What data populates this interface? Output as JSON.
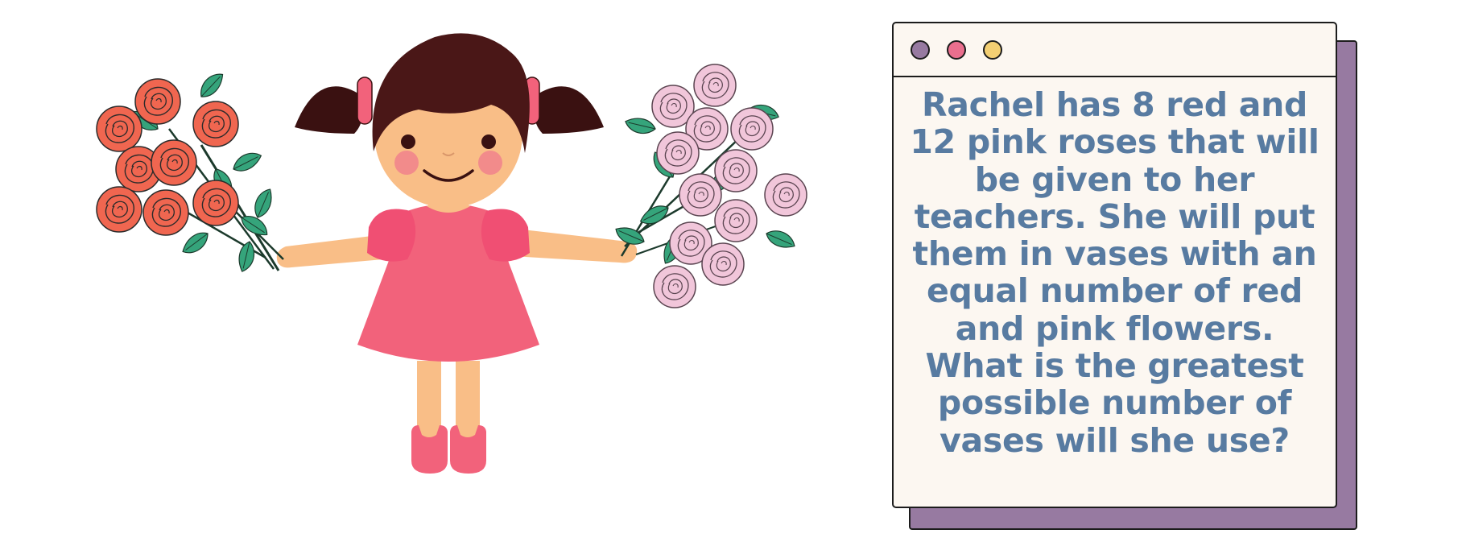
{
  "colors": {
    "window_bg": "#fcf7f1",
    "window_shadow": "#977aa1",
    "text": "#587ba1",
    "dot_purple": "#977aa1",
    "dot_pink": "#ea6f8e",
    "dot_yellow": "#f3cf73",
    "dress": "#f2627b",
    "skin": "#f9be87",
    "hair": "#4a1717",
    "red_rose": "#f06650",
    "pink_rose": "#f1c6da",
    "leaf": "#35a47b"
  },
  "window": {
    "controls": [
      "purple-dot",
      "pink-dot",
      "yellow-dot"
    ],
    "question": "Rachel has 8 red and 12 pink roses that will be given to her teachers. She will put them in vases with an equal number of red and pink flowers. What is the greatest possible number of vases will she use?"
  }
}
